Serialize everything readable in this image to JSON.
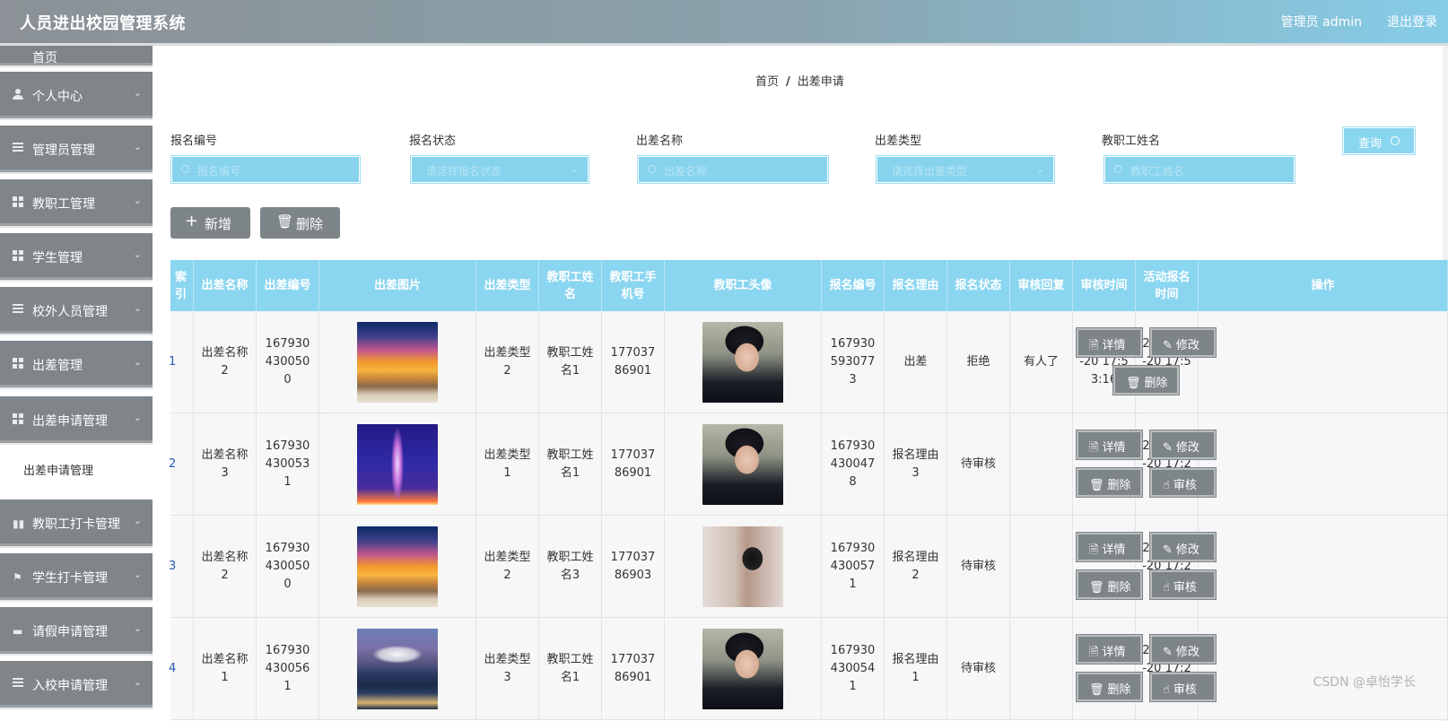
{
  "header": {
    "title": "人员进出校园管理系统",
    "user": "管理员 admin",
    "logout": "退出登录"
  },
  "sidebar": {
    "partial_item": "首页",
    "items": [
      {
        "label": "个人中心",
        "icon": "person-icon"
      },
      {
        "label": "管理员管理",
        "icon": "list-icon"
      },
      {
        "label": "教职工管理",
        "icon": "grid-icon"
      },
      {
        "label": "学生管理",
        "icon": "grid-icon"
      },
      {
        "label": "校外人员管理",
        "icon": "list-icon"
      },
      {
        "label": "出差管理",
        "icon": "grid-icon"
      },
      {
        "label": "出差申请管理",
        "icon": "grid-icon"
      },
      {
        "label": "教职工打卡管理",
        "icon": "bar-chart-icon"
      },
      {
        "label": "学生打卡管理",
        "icon": "flag-icon"
      },
      {
        "label": "请假申请管理",
        "icon": "ticket-icon"
      },
      {
        "label": "入校申请管理",
        "icon": "sliders-icon"
      }
    ],
    "sub_item": "出差申请管理"
  },
  "breadcrumb": {
    "home": "首页",
    "sep": "/",
    "current": "出差申请"
  },
  "filters": {
    "f1": {
      "label": "报名编号",
      "placeholder": "报名编号"
    },
    "f2": {
      "label": "报名状态",
      "placeholder": "请选择报名状态"
    },
    "f3": {
      "label": "出差名称",
      "placeholder": "出差名称"
    },
    "f4": {
      "label": "出差类型",
      "placeholder": "请选择出差类型"
    },
    "f5": {
      "label": "教职工姓名",
      "placeholder": "教职工姓名"
    },
    "query": "查询"
  },
  "actions": {
    "add": "新增",
    "delete": "删除"
  },
  "table": {
    "headers": [
      "索引",
      "出差名称",
      "出差编号",
      "出差图片",
      "出差类型",
      "教职工姓名",
      "教职工手机号",
      "教职工头像",
      "报名编号",
      "报名理由",
      "报名状态",
      "审核回复",
      "审核时间",
      "活动报名时间",
      "操作"
    ],
    "ops": {
      "detail": "详情",
      "edit": "修改",
      "delete": "删除",
      "review": "审核"
    },
    "rows": [
      {
        "idx": "1",
        "name": "出差名称2",
        "code": "1679304300500",
        "pic": "sunset",
        "type": "出差类型2",
        "staff": "教职工姓名1",
        "phone": "17703786901",
        "avatar": "face",
        "regno": "1679305930773",
        "reason": "出差",
        "status": "拒绝",
        "reply": "有人了",
        "review_time": "2023-03-20 17:53:16",
        "reg_time": "2023-03-20 17:52:18"
      },
      {
        "idx": "2",
        "name": "出差名称3",
        "code": "1679304300531",
        "pic": "paris",
        "type": "出差类型1",
        "staff": "教职工姓名1",
        "phone": "17703786901",
        "avatar": "face",
        "regno": "1679304300478",
        "reason": "报名理由3",
        "status": "待审核",
        "reply": "",
        "review_time": "",
        "reg_time": "2023-03-20 17:25:00"
      },
      {
        "idx": "3",
        "name": "出差名称2",
        "code": "1679304300500",
        "pic": "sunset",
        "type": "出差类型2",
        "staff": "教职工姓名3",
        "phone": "17703786903",
        "avatar": "back",
        "regno": "1679304300571",
        "reason": "报名理由2",
        "status": "待审核",
        "reply": "",
        "review_time": "",
        "reg_time": "2023-03-20 17:25:00"
      },
      {
        "idx": "4",
        "name": "出差名称1",
        "code": "1679304300561",
        "pic": "fuji",
        "type": "出差类型3",
        "staff": "教职工姓名1",
        "phone": "17703786901",
        "avatar": "face",
        "regno": "1679304300541",
        "reason": "报名理由1",
        "status": "待审核",
        "reply": "",
        "review_time": "",
        "reg_time": "2023-03-20 17:25:00"
      }
    ]
  },
  "watermark": "CSDN @卓怡学长"
}
